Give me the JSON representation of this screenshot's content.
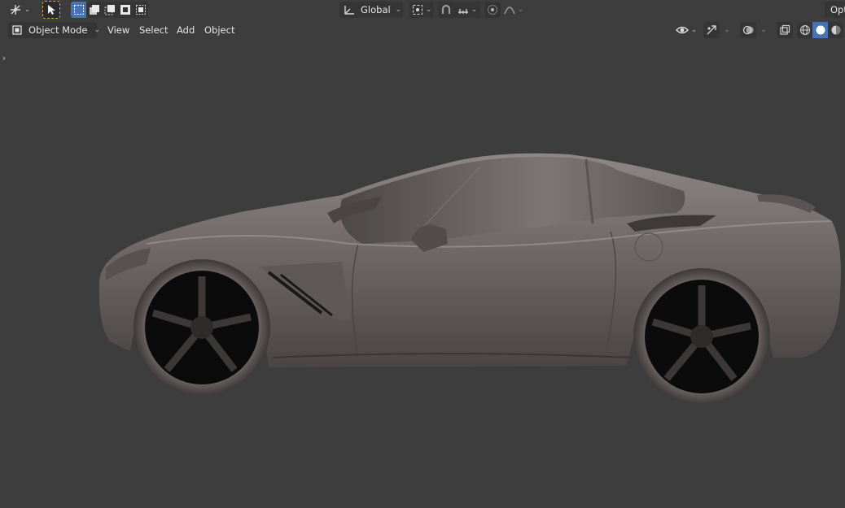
{
  "toolbar": {
    "transform_orientation": "Global",
    "options_label": "Opt"
  },
  "header": {
    "mode_label": "Object Mode",
    "menus": [
      "View",
      "Select",
      "Add",
      "Object"
    ]
  },
  "icons": {
    "transform_pivot": "gizmo-transform-icon",
    "select_tool": "cursor-arrow-icon",
    "select_modes": [
      "select-box-new-icon",
      "select-box-extend-icon",
      "select-box-subtract-icon",
      "select-box-invert-icon",
      "select-box-intersect-icon"
    ],
    "orientation": "orientation-axes-icon",
    "pivot_point": "pivot-point-icon",
    "snap": "magnet-icon",
    "snap_target": "snap-increment-icon",
    "proportional": "proportional-edit-icon",
    "falloff": "falloff-curve-icon",
    "visibility": "eye-icon",
    "gizmo": "gizmo-icon",
    "overlays": "overlay-icon",
    "xray": "xray-icon",
    "shading_wireframe": "wireframe-shading-icon",
    "shading_solid": "solid-shading-icon",
    "shading_material": "material-shading-icon"
  },
  "colors": {
    "viewport_bg": "#3d3d3d",
    "accent": "#4772b3",
    "button_bg": "#353535"
  },
  "scene": {
    "object": "sports-car-model"
  }
}
